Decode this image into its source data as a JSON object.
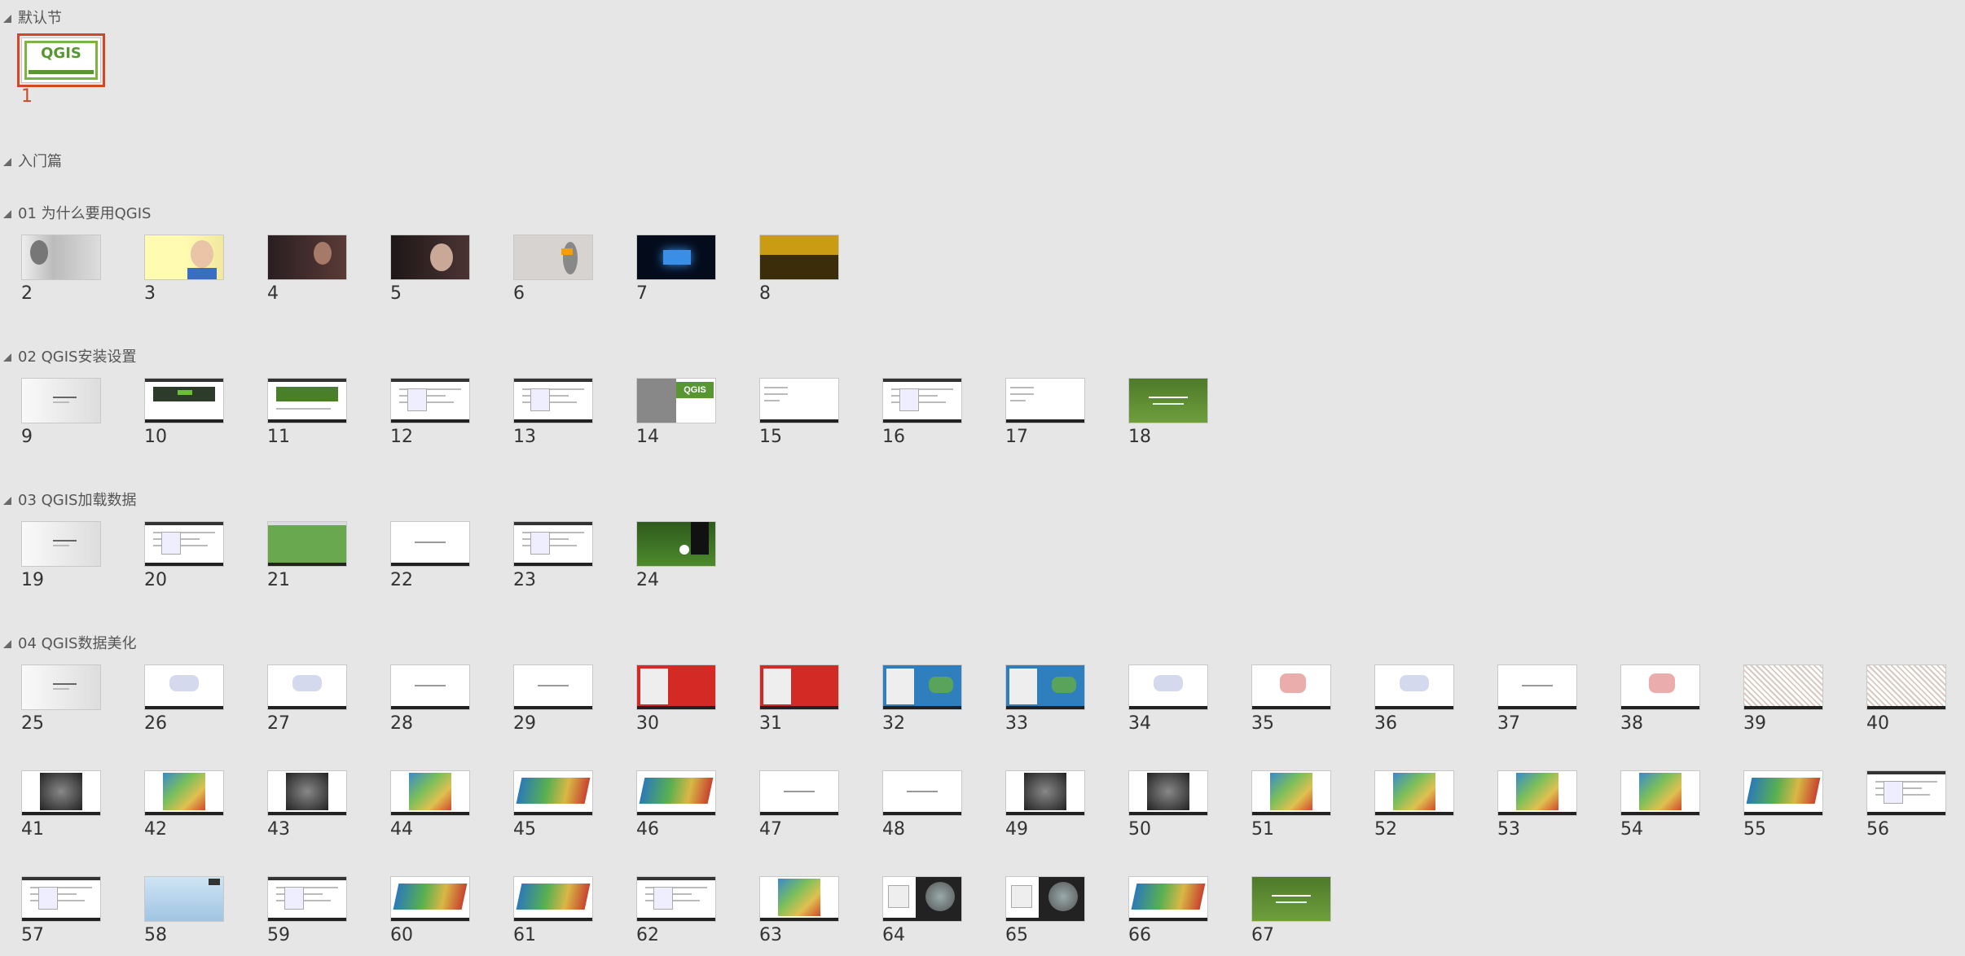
{
  "sections": [
    {
      "title": "默认节",
      "slides": [
        {
          "n": "1",
          "v": "qgis",
          "selected": true
        }
      ]
    },
    {
      "title": "入门篇",
      "slides": []
    },
    {
      "title": "01 为什么要用QGIS",
      "slides": [
        {
          "n": "2",
          "v": "gray"
        },
        {
          "n": "3",
          "v": "yellow"
        },
        {
          "n": "4",
          "v": "darkred"
        },
        {
          "n": "5",
          "v": "darkred2"
        },
        {
          "n": "6",
          "v": "lightgray"
        },
        {
          "n": "7",
          "v": "blue"
        },
        {
          "n": "8",
          "v": "gold"
        }
      ]
    },
    {
      "title": "02 QGIS安装设置",
      "slides": [
        {
          "n": "9",
          "v": "whitegray"
        },
        {
          "n": "10",
          "v": "greenweb"
        },
        {
          "n": "11",
          "v": "greenweb2"
        },
        {
          "n": "12",
          "v": "doc"
        },
        {
          "n": "13",
          "v": "doc"
        },
        {
          "n": "14",
          "v": "qgis32"
        },
        {
          "n": "15",
          "v": "white"
        },
        {
          "n": "16",
          "v": "doc"
        },
        {
          "n": "17",
          "v": "white"
        },
        {
          "n": "18",
          "v": "grass"
        }
      ]
    },
    {
      "title": "03 QGIS加载数据",
      "slides": [
        {
          "n": "19",
          "v": "whitegray"
        },
        {
          "n": "20",
          "v": "doc"
        },
        {
          "n": "21",
          "v": "greenfield"
        },
        {
          "n": "22",
          "v": "whitetext"
        },
        {
          "n": "23",
          "v": "doc"
        },
        {
          "n": "24",
          "v": "soccer"
        }
      ]
    },
    {
      "title": "04 QGIS数据美化",
      "slides": [
        {
          "n": "25",
          "v": "whitegray"
        },
        {
          "n": "26",
          "v": "mapwhite"
        },
        {
          "n": "27",
          "v": "mapwhite"
        },
        {
          "n": "28",
          "v": "whitetext"
        },
        {
          "n": "29",
          "v": "whitetext"
        },
        {
          "n": "30",
          "v": "redmap"
        },
        {
          "n": "31",
          "v": "redmap"
        },
        {
          "n": "32",
          "v": "bluemap"
        },
        {
          "n": "33",
          "v": "bluemap"
        },
        {
          "n": "34",
          "v": "mapwhite"
        },
        {
          "n": "35",
          "v": "mapred"
        },
        {
          "n": "36",
          "v": "mapwhite"
        },
        {
          "n": "37",
          "v": "whitetext"
        },
        {
          "n": "38",
          "v": "mapred"
        },
        {
          "n": "39",
          "v": "speckle"
        },
        {
          "n": "40",
          "v": "speckle"
        },
        {
          "n": "41",
          "v": "darkterrain"
        },
        {
          "n": "42",
          "v": "heat"
        },
        {
          "n": "43",
          "v": "darkterrain"
        },
        {
          "n": "44",
          "v": "heat"
        },
        {
          "n": "45",
          "v": "heat3d"
        },
        {
          "n": "46",
          "v": "heat3d"
        },
        {
          "n": "47",
          "v": "whitetext"
        },
        {
          "n": "48",
          "v": "whitetext"
        },
        {
          "n": "49",
          "v": "darkterrain"
        },
        {
          "n": "50",
          "v": "darkterrain"
        },
        {
          "n": "51",
          "v": "heat"
        },
        {
          "n": "52",
          "v": "heat"
        },
        {
          "n": "53",
          "v": "heat"
        },
        {
          "n": "54",
          "v": "heat"
        },
        {
          "n": "55",
          "v": "heat3d"
        },
        {
          "n": "56",
          "v": "doc"
        },
        {
          "n": "57",
          "v": "doc"
        },
        {
          "n": "58",
          "v": "sky"
        },
        {
          "n": "59",
          "v": "doc"
        },
        {
          "n": "60",
          "v": "heat3d"
        },
        {
          "n": "61",
          "v": "heat3d"
        },
        {
          "n": "62",
          "v": "doc"
        },
        {
          "n": "63",
          "v": "heat"
        },
        {
          "n": "64",
          "v": "globe"
        },
        {
          "n": "65",
          "v": "globe"
        },
        {
          "n": "66",
          "v": "heat3d"
        },
        {
          "n": "67",
          "v": "grass"
        }
      ]
    }
  ]
}
